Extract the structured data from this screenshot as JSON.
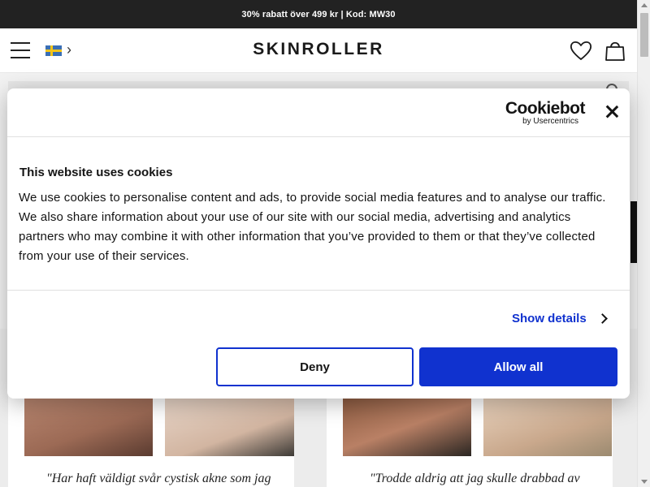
{
  "promo": {
    "text": "30% rabatt över 499 kr | Kod: MW30"
  },
  "header": {
    "logo": "SKINROLLER",
    "language_flag": "sweden-flag-icon",
    "icons": [
      "menu-icon",
      "chevron-right-icon",
      "heart-icon",
      "shopping-bag-icon"
    ]
  },
  "background": {
    "quotes": [
      "\"Har haft väldigt svår cystisk akne som jag",
      "\"Trodde aldrig att jag skulle drabbad av"
    ]
  },
  "cookie_dialog": {
    "brand": "Cookiebot",
    "brand_sub": "by Usercentrics",
    "title": "This website uses cookies",
    "body": "We use cookies to personalise content and ads, to provide social media features and to analyse our traffic. We also share information about your use of our site with our social media, advertising and analytics partners who may combine it with other information that you’ve provided to them or that they’ve collected from your use of their services.",
    "show_details": "Show details",
    "deny_label": "Deny",
    "allow_label": "Allow all"
  },
  "colors": {
    "accent": "#1032cf",
    "promo_bg": "#222222",
    "text": "#141414"
  }
}
